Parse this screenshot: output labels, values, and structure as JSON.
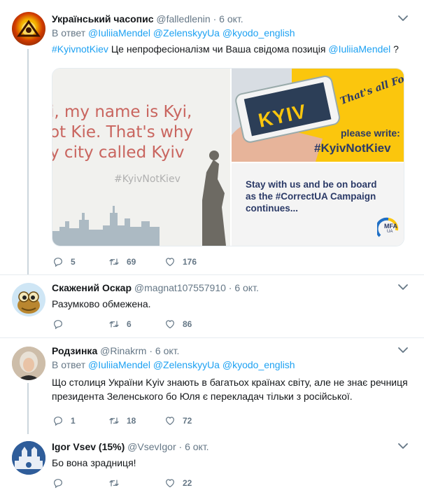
{
  "tweets": [
    {
      "name": "Український часопис",
      "handle": "@falledlenin",
      "time": "6 окт.",
      "reply_prefix": "В ответ",
      "reply_to": [
        "@IuliiaMendel",
        "@ZelenskyyUa",
        "@kyodo_english"
      ],
      "text_parts": [
        "#KyivnotKiev",
        " Це непрофесіоналізм чи Ваша свідома позиція ",
        "@IuliiaMendel",
        " ?"
      ],
      "media": {
        "left_lines": [
          "i, my name is Kyi,",
          "ot Kie. That's why",
          "y city called Kyiv"
        ],
        "left_hashtag": "#KyivNotKiev",
        "phone_text": "KYIV",
        "banner": "That's all Folks!",
        "please_write": "please write:",
        "hashtag": "#KyivNotKiev",
        "stay_lines": [
          "Stay with us and be on board",
          "as the #CorrectUA Campaign",
          "continues..."
        ],
        "mfa_logo": "MFA",
        "mfa_sub": "UA"
      },
      "replies": "5",
      "retweets": "69",
      "likes": "176"
    },
    {
      "name": "Скажений Оскар",
      "handle": "@magnat107557910",
      "time": "6 окт.",
      "text": "Разумково обмежена.",
      "replies": "",
      "retweets": "6",
      "likes": "86"
    },
    {
      "name": "Родзинка",
      "handle": "@Rinakrm",
      "time": "6 окт.",
      "reply_prefix": "В ответ",
      "reply_to": [
        "@IuliiaMendel",
        "@ZelenskyyUa",
        "@kyodo_english"
      ],
      "text": "Що столиця України Kyiv знають в багатьох країнах світу, але не знає речниця президента Зеленського бо Юля є перекладач тільки з російської.",
      "replies": "1",
      "retweets": "18",
      "likes": "72"
    },
    {
      "name": "Igor Vsev (15%)",
      "handle": "@VsevIgor",
      "time": "6 окт.",
      "text": "Бо вона зрадниця!",
      "replies": "",
      "retweets": "",
      "likes": "22"
    }
  ],
  "colors": {
    "link": "#1da1f2",
    "muted": "#657786",
    "thread": "#ccd6dd"
  }
}
